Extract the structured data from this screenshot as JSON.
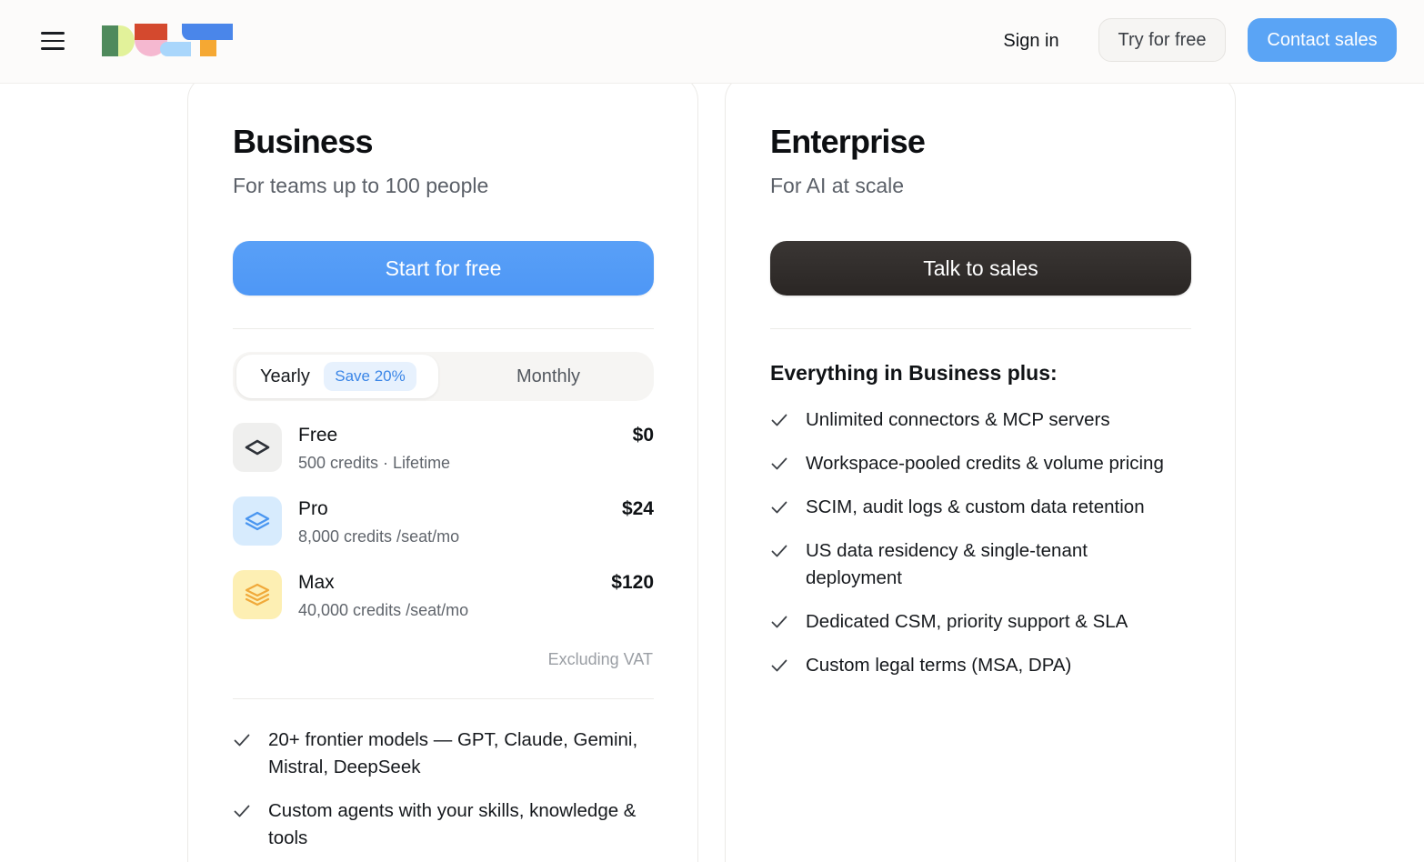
{
  "header": {
    "menu_icon": "hamburger-menu-icon",
    "logo_name": "dust-logo",
    "sign_in": "Sign in",
    "try_free": "Try for free",
    "contact_sales": "Contact sales",
    "accent": "#5aa4f5"
  },
  "business": {
    "title": "Business",
    "subtitle": "For teams up to 100 people",
    "cta": "Start for free",
    "toggle": {
      "yearly": "Yearly",
      "save_badge": "Save 20%",
      "monthly": "Monthly",
      "selected": "Yearly"
    },
    "plans": [
      {
        "name": "Free",
        "detail": "500 credits · Lifetime",
        "price": "$0",
        "icon": "single-layer-icon",
        "icon_bg": "#efefee",
        "icon_color": "#2d3138"
      },
      {
        "name": "Pro",
        "detail": "8,000 credits /seat/mo",
        "price": "$24",
        "icon": "double-layer-icon",
        "icon_bg": "#d7ebfd",
        "icon_color": "#4a96f0"
      },
      {
        "name": "Max",
        "detail": "40,000 credits /seat/mo",
        "price": "$120",
        "icon": "triple-layer-icon",
        "icon_bg": "#fdefb3",
        "icon_color": "#f0a93a"
      }
    ],
    "vat_note": "Excluding VAT",
    "features": [
      "20+ frontier models — GPT, Claude, Gemini, Mistral, DeepSeek",
      "Custom agents with your skills, knowledge & tools"
    ]
  },
  "enterprise": {
    "title": "Enterprise",
    "subtitle": "For AI at scale",
    "cta": "Talk to sales",
    "features_heading": "Everything in Business plus:",
    "features": [
      "Unlimited connectors & MCP servers",
      "Workspace-pooled credits & volume pricing",
      "SCIM, audit logs & custom data retention",
      "US data residency & single-tenant deployment",
      "Dedicated CSM, priority support & SLA",
      "Custom legal terms (MSA, DPA)"
    ]
  }
}
